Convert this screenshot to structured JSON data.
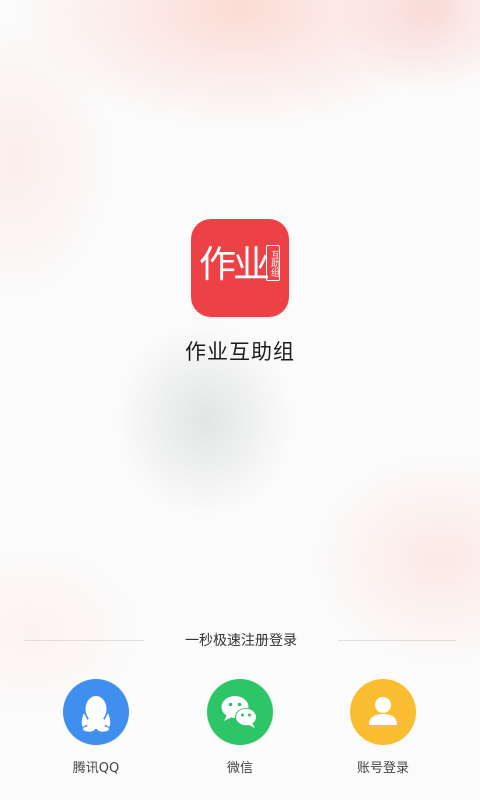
{
  "app": {
    "icon_text": "作业",
    "icon_tag": "互助组",
    "name": "作业互助组",
    "icon_color": "#ec4145"
  },
  "login": {
    "divider_text": "一秒极速注册登录",
    "options": [
      {
        "label": "腾讯QQ",
        "icon": "qq-icon",
        "color": "#3f8ff0"
      },
      {
        "label": "微信",
        "icon": "wechat-icon",
        "color": "#2ec468"
      },
      {
        "label": "账号登录",
        "icon": "account-icon",
        "color": "#fbbd31"
      }
    ]
  }
}
